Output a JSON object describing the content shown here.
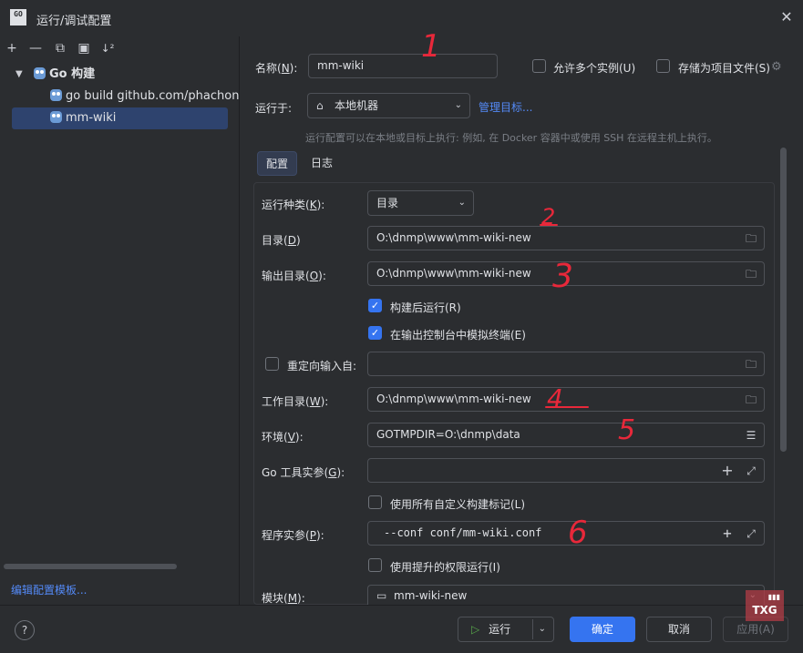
{
  "window": {
    "logo_text": "GO",
    "title": "运行/调试配置"
  },
  "toolbar": {
    "add": "+",
    "remove": "—",
    "copy": "⧉",
    "folder": "▣",
    "sort": "↓²"
  },
  "tree": {
    "group": "Go 构建",
    "items": [
      "go build github.com/phachon/mm-wiki",
      "mm-wiki"
    ],
    "selected_index": 1
  },
  "left_footer": {
    "edit_templates": "编辑配置模板..."
  },
  "form": {
    "name_label": "名称(",
    "name_mnemonic": "N",
    "name_label_end": "):",
    "name_value": "mm-wiki",
    "allow_parallel": "允许多个实例(U)",
    "store_as_file": "存储为项目文件(S)",
    "run_on_label": "运行于:",
    "run_on_value": "本地机器",
    "manage_targets": "管理目标...",
    "run_on_hint": "运行配置可以在本地或目标上执行: 例如, 在 Docker 容器中或使用 SSH 在远程主机上执行。"
  },
  "tabs": [
    "配置",
    "日志"
  ],
  "config": {
    "run_kind_label": "运行种类(",
    "run_kind_mn": "K",
    "run_kind_value": "目录",
    "directory_label": "目录(",
    "directory_mn": "D",
    "directory_value": "O:\\dnmp\\www\\mm-wiki-new",
    "output_dir_label": "输出目录(",
    "output_dir_mn": "O",
    "output_dir_value": "O:\\dnmp\\www\\mm-wiki-new",
    "run_after_build": "构建后运行(R)",
    "emulate_terminal": "在输出控制台中模拟终端(E)",
    "redirect_input": "重定向输入自:",
    "redirect_value": "",
    "working_dir_label": "工作目录(",
    "working_dir_mn": "W",
    "working_dir_value": "O:\\dnmp\\www\\mm-wiki-new",
    "env_label": "环境(",
    "env_mn": "V",
    "env_value": "GOTMPDIR=O:\\dnmp\\data",
    "go_tool_args_label": "Go 工具实参(",
    "go_tool_args_mn": "G",
    "go_tool_args_value": "",
    "use_custom_tags": "使用所有自定义构建标记(L)",
    "program_args_label": "程序实参(",
    "program_args_mn": "P",
    "program_args_value": "--conf conf/mm-wiki.conf",
    "elevated": "使用提升的权限运行(I)",
    "module_label": "模块(",
    "module_mn": "M",
    "module_value": "mm-wiki-new"
  },
  "buttons": {
    "help": "?",
    "run": "运行",
    "ok": "确定",
    "cancel": "取消",
    "apply": "应用(A)"
  },
  "watermark": "TXG",
  "annotations": [
    "1",
    "2",
    "3",
    "4",
    "5",
    "6"
  ],
  "colors": {
    "accent": "#3574f0",
    "link": "#548af7",
    "annotation": "#e8283a"
  }
}
